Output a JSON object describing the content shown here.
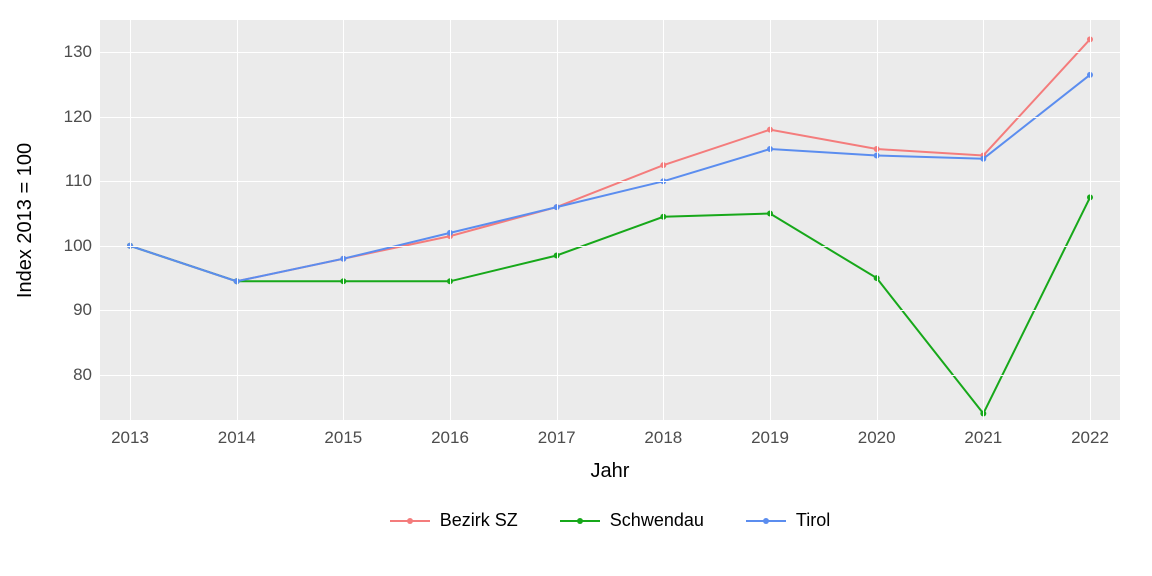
{
  "chart_data": {
    "type": "line",
    "xlabel": "Jahr",
    "ylabel": "Index  2013  = 100",
    "categories": [
      "2013",
      "2014",
      "2015",
      "2016",
      "2017",
      "2018",
      "2019",
      "2020",
      "2021",
      "2022"
    ],
    "y_ticks": [
      80,
      90,
      100,
      110,
      120,
      130
    ],
    "ylim": [
      73,
      135
    ],
    "series": [
      {
        "name": "Bezirk SZ",
        "color": "#f47c7c",
        "values": [
          100,
          94.5,
          98,
          101.5,
          106,
          112.5,
          118,
          115,
          114,
          132
        ]
      },
      {
        "name": "Schwendau",
        "color": "#17a81a",
        "values": [
          100,
          94.5,
          94.5,
          94.5,
          98.5,
          104.5,
          105,
          95,
          74,
          107.5
        ]
      },
      {
        "name": "Tirol",
        "color": "#5b8def",
        "values": [
          100,
          94.5,
          98,
          102,
          106,
          110,
          115,
          114,
          113.5,
          126.5
        ]
      }
    ],
    "legend_position": "bottom",
    "grid": true
  }
}
